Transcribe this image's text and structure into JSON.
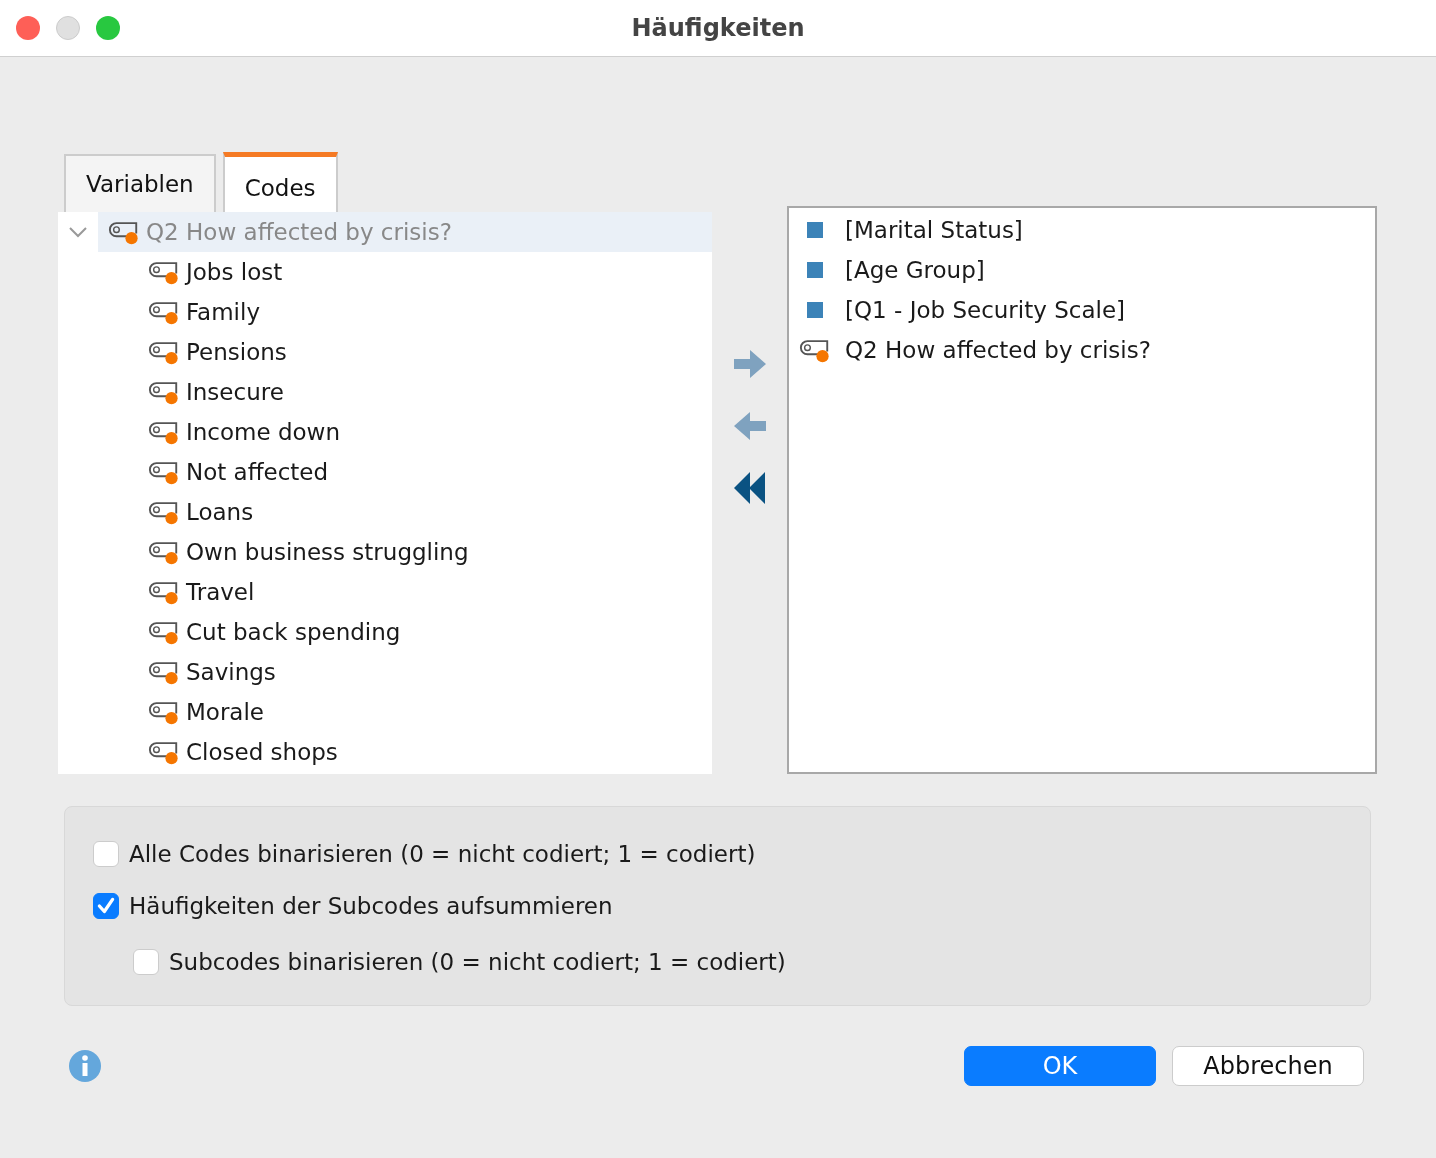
{
  "window": {
    "title": "Häufigkeiten"
  },
  "tabs": [
    {
      "label": "Variablen",
      "selected": false
    },
    {
      "label": "Codes",
      "selected": true
    }
  ],
  "tree": {
    "label": "Q2 How affected by crisis?",
    "expanded": true,
    "selected": true,
    "disabled": true,
    "children": [
      {
        "label": "Jobs lost"
      },
      {
        "label": "Family"
      },
      {
        "label": "Pensions"
      },
      {
        "label": "Insecure"
      },
      {
        "label": "Income down"
      },
      {
        "label": "Not affected"
      },
      {
        "label": "Loans"
      },
      {
        "label": "Own business struggling"
      },
      {
        "label": "Travel"
      },
      {
        "label": "Cut back spending"
      },
      {
        "label": "Savings"
      },
      {
        "label": "Morale"
      },
      {
        "label": "Closed shops"
      }
    ]
  },
  "move_buttons": [
    {
      "kind": "right",
      "disabled": true
    },
    {
      "kind": "left",
      "disabled": true
    },
    {
      "kind": "all-left",
      "disabled": false
    }
  ],
  "selected_list": [
    {
      "kind": "variable",
      "label": "[Marital Status]"
    },
    {
      "kind": "variable",
      "label": "[Age Group]"
    },
    {
      "kind": "variable",
      "label": "[Q1 - Job Security Scale]"
    },
    {
      "kind": "code",
      "label": "Q2 How affected by crisis?"
    }
  ],
  "options": [
    {
      "label": "Alle Codes binarisieren (0 = nicht codiert; 1 = codiert)",
      "checked": false
    },
    {
      "label": "Häufigkeiten der Subcodes aufsummieren",
      "checked": true,
      "children": [
        {
          "label": "Subcodes binarisieren (0 = nicht codiert; 1 = codiert)",
          "checked": false
        }
      ]
    }
  ],
  "buttons": [
    {
      "label": "OK",
      "default": true
    },
    {
      "label": "Abbrechen",
      "default": false
    }
  ]
}
